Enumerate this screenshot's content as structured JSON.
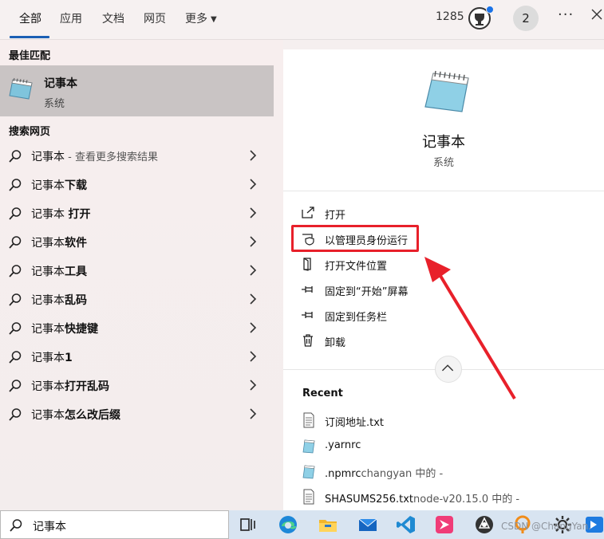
{
  "tabs": [
    {
      "label": "全部",
      "active": true
    },
    {
      "label": "应用"
    },
    {
      "label": "文档"
    },
    {
      "label": "网页"
    },
    {
      "label": "更多"
    }
  ],
  "header": {
    "points": "1285",
    "avatar_initial": "2",
    "more_label": "···"
  },
  "best_match": {
    "heading": "最佳匹配",
    "name": "记事本",
    "type": "系统"
  },
  "web_search": {
    "heading": "搜索网页",
    "items": [
      {
        "prefix": "记事本",
        "suffix": " - 查看更多搜索结果"
      },
      {
        "prefix": "记事本",
        "bold": "下载"
      },
      {
        "prefix": "记事本 ",
        "bold": "打开"
      },
      {
        "prefix": "记事本",
        "bold": "软件"
      },
      {
        "prefix": "记事本",
        "bold": "工具"
      },
      {
        "prefix": "记事本",
        "bold": "乱码"
      },
      {
        "prefix": "记事本",
        "bold": "快捷键"
      },
      {
        "prefix": "记事本",
        "bold": "1"
      },
      {
        "prefix": "记事本",
        "bold": "打开乱码"
      },
      {
        "prefix": "记事本",
        "bold": "怎么改后缀"
      }
    ]
  },
  "detail": {
    "title": "记事本",
    "type": "系统",
    "actions": [
      {
        "label": "打开",
        "icon": "open-icon"
      },
      {
        "label": "以管理员身份运行",
        "icon": "shield-icon"
      },
      {
        "label": "打开文件位置",
        "icon": "folder-location-icon"
      },
      {
        "label": "固定到“开始”屏幕",
        "icon": "pin-icon"
      },
      {
        "label": "固定到任务栏",
        "icon": "pin-icon"
      },
      {
        "label": "卸载",
        "icon": "trash-icon"
      }
    ],
    "recent_heading": "Recent",
    "recent": [
      {
        "name": "订阅地址.txt",
        "location": ""
      },
      {
        "name": ".yarnrc",
        "location": ""
      },
      {
        "name": ".npmrc",
        "location": "changyan 中的 -"
      },
      {
        "name": "SHASUMS256.txt",
        "location": "node-v20.15.0 中的 -"
      }
    ]
  },
  "taskbar": {
    "search_value": "记事本",
    "watermark": "CSDN @ChangYan."
  },
  "colors": {
    "accent": "#1a5fb4",
    "highlight_red": "#e8202a"
  }
}
